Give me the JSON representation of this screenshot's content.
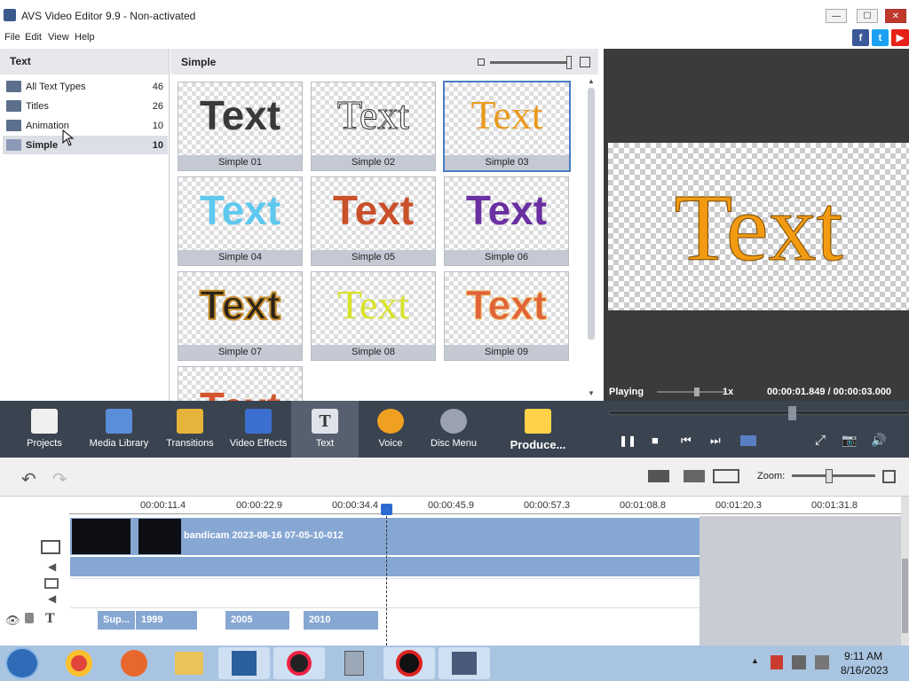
{
  "window": {
    "title": "AVS Video Editor 9.9 - Non-activated",
    "minimize": "—",
    "maximize": "☐",
    "close": "✕"
  },
  "menu": [
    "File",
    "Edit",
    "View",
    "Help"
  ],
  "social": {
    "facebook": "f",
    "twitter": "t",
    "youtube": "▶"
  },
  "left_panel": {
    "header": "Text",
    "categories": [
      {
        "label": "All Text Types",
        "count": "46"
      },
      {
        "label": "Titles",
        "count": "26"
      },
      {
        "label": "Animation",
        "count": "10"
      },
      {
        "label": "Simple",
        "count": "10"
      }
    ]
  },
  "grid": {
    "header": "Simple",
    "tiles": [
      {
        "label": "Simple 01",
        "text": "Text",
        "color": "#3a3a3a"
      },
      {
        "label": "Simple 02",
        "text": "Text",
        "color": "#ffffff"
      },
      {
        "label": "Simple 03",
        "text": "Text",
        "color": "#e99a1e"
      },
      {
        "label": "Simple 04",
        "text": "Text",
        "color": "#5fc8ef"
      },
      {
        "label": "Simple 05",
        "text": "Text",
        "color": "#c9502b"
      },
      {
        "label": "Simple 06",
        "text": "Text",
        "color": "#6a2fa0"
      },
      {
        "label": "Simple 07",
        "text": "Text",
        "color": "#2a2218"
      },
      {
        "label": "Simple 08",
        "text": "Text",
        "color": "#d8e22a"
      },
      {
        "label": "Simple 09",
        "text": "Text",
        "color": "#e0633a"
      },
      {
        "label": "",
        "text": "Text",
        "color": "#d4562e"
      }
    ]
  },
  "preview": {
    "text": "Text",
    "status": "Playing",
    "speed": "1x",
    "time": "00:00:01.849 / 00:00:03.000"
  },
  "toolbar": {
    "tools": [
      {
        "label": "Projects",
        "color": "#f0f0f0"
      },
      {
        "label": "Media Library",
        "color": "#5a8ed8"
      },
      {
        "label": "Transitions",
        "color": "#e6b43a"
      },
      {
        "label": "Video Effects",
        "color": "#3c6fcf"
      },
      {
        "label": "Text",
        "color": "#dfe3ea"
      },
      {
        "label": "Voice",
        "color": "#f0a020"
      },
      {
        "label": "Disc Menu",
        "color": "#9aa2b0"
      },
      {
        "label": "Produce...",
        "color": "#ffd24a"
      }
    ]
  },
  "playback": {
    "pause": "❚❚",
    "stop": "■",
    "prev": "⏮",
    "next": "⏭",
    "fullscreen": "⤢",
    "snapshot": "📷",
    "volume": "🔊"
  },
  "timeline": {
    "zoom_label": "Zoom:",
    "ruler": [
      "00:00:11.4",
      "00:00:22.9",
      "00:00:34.4",
      "00:00:45.9",
      "00:00:57.3",
      "00:01:08.8",
      "00:01:20.3",
      "00:01:31.8"
    ],
    "video_clip": "bandicam 2023-08-16 07-05-10-012",
    "text_clips": [
      "Sup...",
      "1999",
      "2005",
      "2010"
    ]
  },
  "taskbar": {
    "time": "9:11 AM",
    "date": "8/16/2023"
  }
}
